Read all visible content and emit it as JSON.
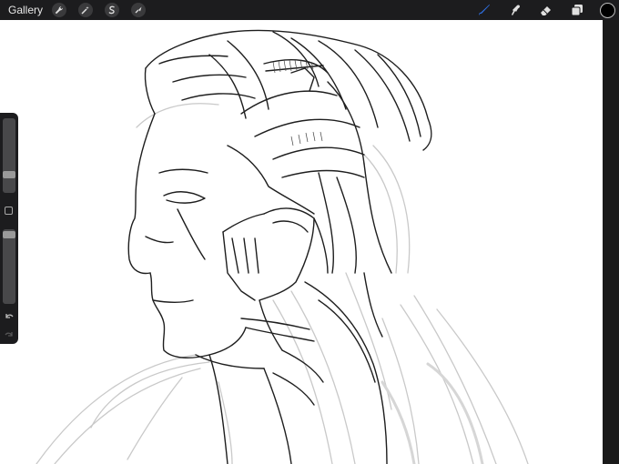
{
  "toolbar": {
    "gallery_label": "Gallery",
    "left_tools": [
      {
        "icon": "wrench-icon",
        "name": "actions"
      },
      {
        "icon": "magic-wand-icon",
        "name": "adjustments"
      },
      {
        "icon": "selection-s-icon",
        "name": "selection"
      },
      {
        "icon": "transform-arrow-icon",
        "name": "transform"
      }
    ],
    "right_tools": [
      {
        "icon": "brush-icon",
        "name": "brush",
        "active": true
      },
      {
        "icon": "smudge-icon",
        "name": "smudge"
      },
      {
        "icon": "eraser-icon",
        "name": "eraser"
      },
      {
        "icon": "layers-icon",
        "name": "layers"
      }
    ],
    "active_color": "#000000",
    "accent_color": "#2f6fe0"
  },
  "sidebar": {
    "brush_size_level": 0.2,
    "opacity_level": 0.96,
    "controls": [
      "brush-size-slider",
      "modify-button",
      "opacity-slider",
      "undo-icon",
      "redo-icon"
    ]
  },
  "canvas": {
    "subject": "line-art-sketch"
  }
}
